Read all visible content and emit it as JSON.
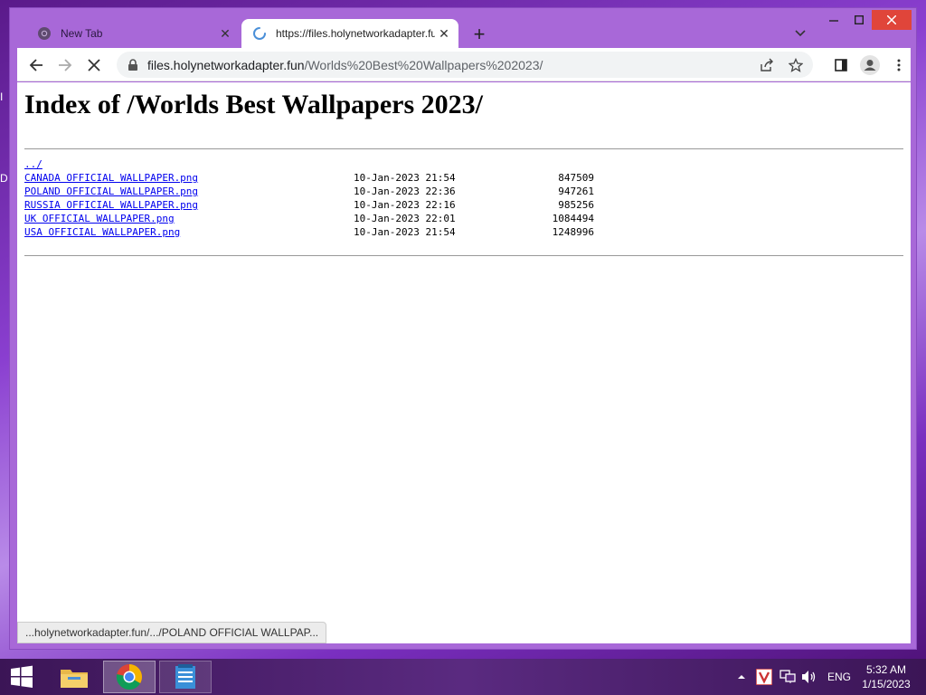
{
  "desktop": {
    "frag1": "I",
    "frag2": "D"
  },
  "tabs": [
    {
      "title": "New Tab",
      "favicon": "chrome-icon",
      "active": false
    },
    {
      "title": "https://files.holynetworkadapter.fun",
      "favicon": "loading-spinner-icon",
      "active": true
    }
  ],
  "address": {
    "host": "files.holynetworkadapter.fun",
    "path": "/Worlds%20Best%20Wallpapers%202023/"
  },
  "page": {
    "heading": "Index of /Worlds Best Wallpapers 2023/",
    "parent_link": "../",
    "files": [
      {
        "name": "CANADA OFFICIAL WALLPAPER.png",
        "date": "10-Jan-2023 21:54",
        "size": "847509"
      },
      {
        "name": "POLAND OFFICIAL WALLPAPER.png",
        "date": "10-Jan-2023 22:36",
        "size": "947261"
      },
      {
        "name": "RUSSIA OFFICIAL WALLPAPER.png",
        "date": "10-Jan-2023 22:16",
        "size": "985256"
      },
      {
        "name": "UK OFFICIAL WALLPAPER.png",
        "date": "10-Jan-2023 22:01",
        "size": "1084494"
      },
      {
        "name": "USA OFFICIAL WALLPAPER.png",
        "date": "10-Jan-2023 21:54",
        "size": "1248996"
      }
    ]
  },
  "status_url": "...holynetworkadapter.fun/.../POLAND OFFICIAL WALLPAP...",
  "taskbar": {
    "language": "ENG",
    "time": "5:32 AM",
    "date": "1/15/2023"
  },
  "colors": {
    "link": "#0000ee",
    "close_button": "#e0453a",
    "window_frame": "#a868d8"
  }
}
